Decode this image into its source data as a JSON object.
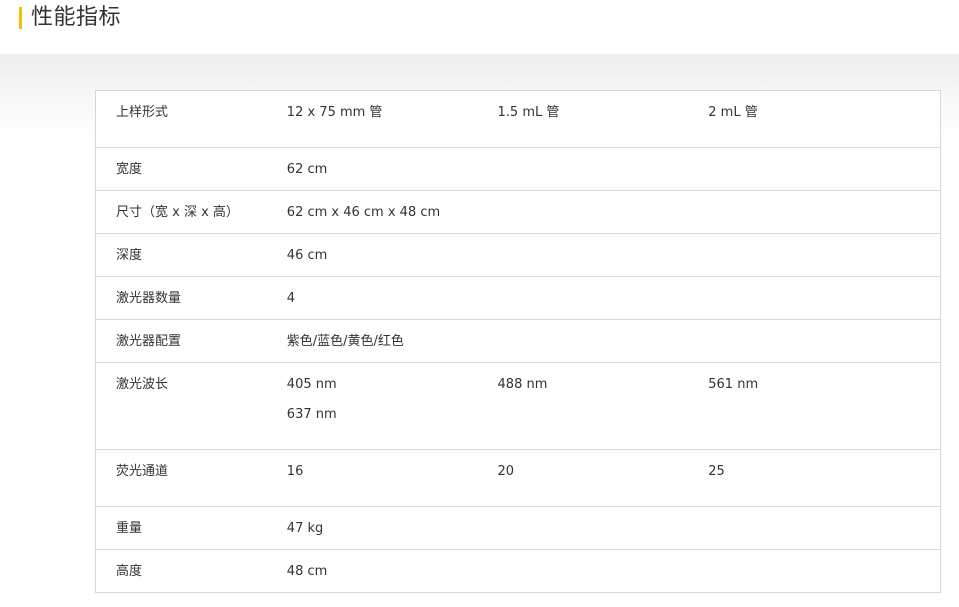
{
  "section": {
    "title": "性能指标"
  },
  "spec_table": {
    "rows": [
      {
        "label": "上样形式",
        "values": [
          "12 x 75 mm 管",
          "1.5 mL 管",
          "2 mL 管"
        ]
      },
      {
        "label": "宽度",
        "values": [
          "62 cm",
          "",
          ""
        ]
      },
      {
        "label": "尺寸（宽 x 深 x 高）",
        "values": [
          "62 cm x 46 cm x 48 cm",
          "",
          ""
        ]
      },
      {
        "label": "深度",
        "values": [
          "46 cm",
          "",
          ""
        ]
      },
      {
        "label": "激光器数量",
        "values": [
          "4",
          "",
          ""
        ]
      },
      {
        "label": "激光器配置",
        "values": [
          "紫色/蓝色/黄色/红色",
          "",
          ""
        ]
      },
      {
        "label": "激光波长",
        "values": [
          "405 nm",
          "488 nm",
          "561 nm"
        ],
        "extra": "637 nm"
      },
      {
        "label": "荧光通道",
        "values": [
          "16",
          "20",
          "25"
        ]
      },
      {
        "label": "重量",
        "values": [
          "47 kg",
          "",
          ""
        ]
      },
      {
        "label": "高度",
        "values": [
          "48 cm",
          "",
          ""
        ]
      }
    ]
  }
}
